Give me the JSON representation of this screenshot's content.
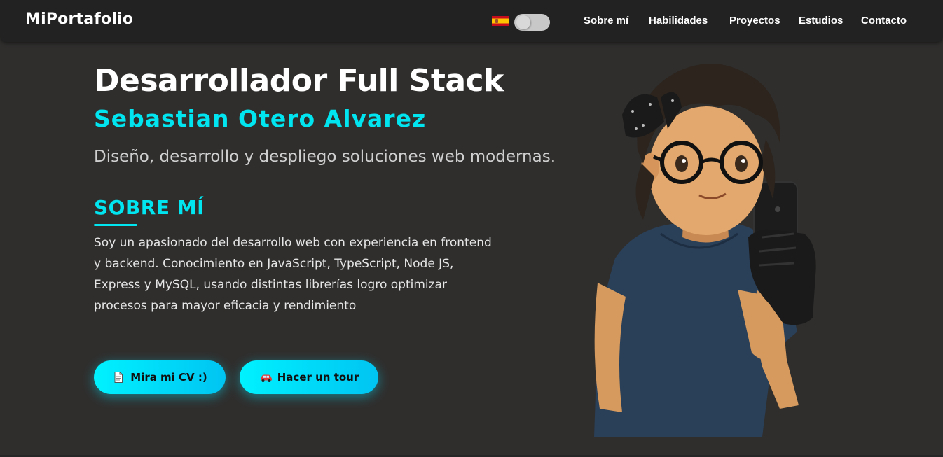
{
  "navbar": {
    "brand": "MiPortafolio",
    "language_flag": "spain-flag-icon",
    "theme_toggle": {
      "state": "off"
    },
    "links": [
      {
        "label": "Sobre mí"
      },
      {
        "label": "Habilidades"
      },
      {
        "label": "Proyectos"
      },
      {
        "label": "Estudios"
      },
      {
        "label": "Contacto"
      }
    ]
  },
  "hero": {
    "title": "Desarrollador Full Stack",
    "name": "Sebastian Otero Alvarez",
    "tagline": "Diseño, desarrollo y despliego soluciones web modernas."
  },
  "about": {
    "heading": "SOBRE MÍ",
    "lines": [
      "Soy un apasionado del desarrollo web con experiencia en frontend",
      "y backend. Conocimiento en JavaScript, TypeScript, Node JS,",
      "Express y MySQL, usando distintas librerías logro optimizar",
      "procesos para mayor eficacia y rendimiento"
    ]
  },
  "buttons": {
    "cv": {
      "label": "Mira mi CV :)",
      "icon": "document-icon"
    },
    "tour": {
      "label": "Hacer un tour",
      "icon": "car-icon"
    }
  },
  "colors": {
    "accent": "#00e5f0",
    "background": "#2f2e2d",
    "navbar": "#222222"
  }
}
